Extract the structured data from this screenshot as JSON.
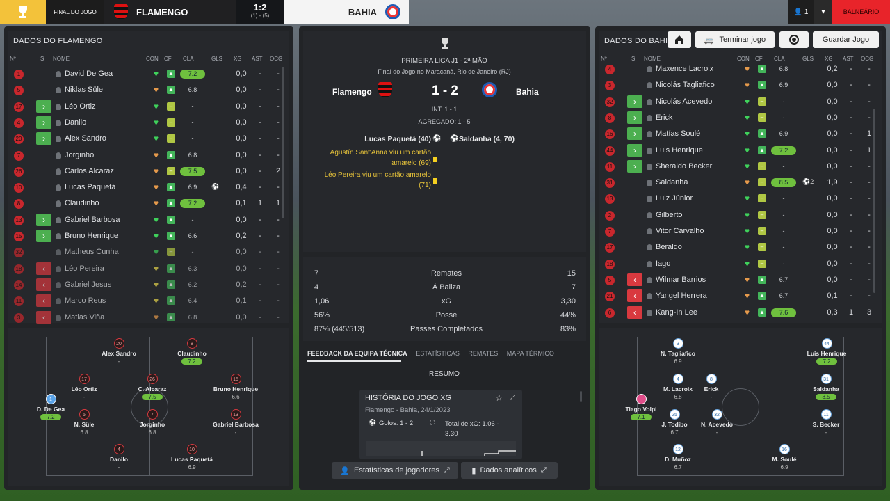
{
  "topbar": {
    "final_label": "FINAL DO JOGO",
    "home": "FLAMENGO",
    "score": "1:2",
    "score_sub": "(1) - (5)",
    "away": "BAHIA",
    "user_count": "1",
    "balneario": "BALNEÁRIO"
  },
  "actions": {
    "home_icon": "home-icon",
    "end_label": "Terminar jogo",
    "save_label": "Guardar Jogo"
  },
  "columns": {
    "num": "Nº",
    "s": "S",
    "name": "NOME",
    "con": "CON",
    "cf": "CF",
    "cla": "CLA",
    "gls": "GLS",
    "xg": "XG",
    "ast": "AST",
    "ocg": "OCG"
  },
  "left_panel": {
    "title": "DADOS DO FLAMENGO",
    "players": [
      {
        "num": "1",
        "sub": "",
        "name": "David De Gea",
        "con": "green",
        "cf": "up",
        "cla": "7.2",
        "cla_hi": true,
        "gls": "",
        "xg": "0,0",
        "ast": "-",
        "ocg": "-"
      },
      {
        "num": "5",
        "sub": "",
        "name": "Niklas Süle",
        "con": "orange",
        "cf": "up",
        "cla": "6.8",
        "cla_hi": false,
        "gls": "",
        "xg": "0,0",
        "ast": "-",
        "ocg": "-"
      },
      {
        "num": "17",
        "sub": "in",
        "name": "Léo Ortiz",
        "con": "green",
        "cf": "flat",
        "cla": "-",
        "cla_hi": false,
        "gls": "",
        "xg": "0,0",
        "ast": "-",
        "ocg": "-"
      },
      {
        "num": "4",
        "sub": "in",
        "name": "Danilo",
        "con": "green",
        "cf": "flat",
        "cla": "-",
        "cla_hi": false,
        "gls": "",
        "xg": "0,0",
        "ast": "-",
        "ocg": "-"
      },
      {
        "num": "20",
        "sub": "in",
        "name": "Alex Sandro",
        "con": "green",
        "cf": "flat",
        "cla": "-",
        "cla_hi": false,
        "gls": "",
        "xg": "0,0",
        "ast": "-",
        "ocg": "-"
      },
      {
        "num": "7",
        "sub": "",
        "name": "Jorginho",
        "con": "orange",
        "cf": "up",
        "cla": "6.8",
        "cla_hi": false,
        "gls": "",
        "xg": "0,0",
        "ast": "-",
        "ocg": "-"
      },
      {
        "num": "26",
        "sub": "",
        "name": "Carlos Alcaraz",
        "con": "orange",
        "cf": "flat",
        "cla": "7.5",
        "cla_hi": true,
        "gls": "",
        "xg": "0,0",
        "ast": "-",
        "ocg": "2"
      },
      {
        "num": "10",
        "sub": "",
        "name": "Lucas Paquetá",
        "con": "orange",
        "cf": "up",
        "cla": "6.9",
        "cla_hi": false,
        "gls": "⚽",
        "xg": "0,4",
        "ast": "-",
        "ocg": "-"
      },
      {
        "num": "8",
        "sub": "",
        "name": "Claudinho",
        "con": "orange",
        "cf": "up",
        "cla": "7.2",
        "cla_hi": true,
        "gls": "",
        "xg": "0,1",
        "ast": "1",
        "ocg": "1"
      },
      {
        "num": "13",
        "sub": "in",
        "name": "Gabriel Barbosa",
        "con": "green",
        "cf": "up",
        "cla": "-",
        "cla_hi": false,
        "gls": "",
        "xg": "0,0",
        "ast": "-",
        "ocg": "-"
      },
      {
        "num": "15",
        "sub": "in",
        "name": "Bruno Henrique",
        "con": "green",
        "cf": "up",
        "cla": "6.6",
        "cla_hi": false,
        "gls": "",
        "xg": "0,2",
        "ast": "-",
        "ocg": "-"
      },
      {
        "num": "32",
        "sub": "",
        "name": "Matheus Cunha",
        "con": "green",
        "cf": "flat",
        "cla": "-",
        "cla_hi": false,
        "gls": "",
        "xg": "0,0",
        "ast": "-",
        "ocg": "-"
      },
      {
        "num": "18",
        "sub": "out",
        "name": "Léo Pereira",
        "con": "yellow",
        "cf": "up",
        "cla": "6.3",
        "cla_hi": false,
        "gls": "",
        "xg": "0,0",
        "ast": "-",
        "ocg": "-"
      },
      {
        "num": "14",
        "sub": "out",
        "name": "Gabriel Jesus",
        "con": "yellow",
        "cf": "up",
        "cla": "6.2",
        "cla_hi": false,
        "gls": "",
        "xg": "0,2",
        "ast": "-",
        "ocg": "-"
      },
      {
        "num": "11",
        "sub": "out",
        "name": "Marco Reus",
        "con": "yellow",
        "cf": "up",
        "cla": "6.4",
        "cla_hi": false,
        "gls": "",
        "xg": "0,1",
        "ast": "-",
        "ocg": "-"
      },
      {
        "num": "3",
        "sub": "out",
        "name": "Matias Viña",
        "con": "orange",
        "cf": "up",
        "cla": "6.8",
        "cla_hi": false,
        "gls": "",
        "xg": "0,0",
        "ast": "-",
        "ocg": "-"
      }
    ],
    "lineup": [
      {
        "num": "20",
        "name": "Alex Sandro",
        "rating": "-",
        "hi": false
      },
      {
        "num": "8",
        "name": "Claudinho",
        "rating": "7.2",
        "hi": true
      },
      {
        "num": "17",
        "name": "Léo Ortiz",
        "rating": "-",
        "hi": false
      },
      {
        "num": "26",
        "name": "C. Alcaraz",
        "rating": "7.5",
        "hi": true
      },
      {
        "num": "15",
        "name": "Bruno Henrique",
        "rating": "6.6",
        "hi": false
      },
      {
        "num": "1",
        "name": "D. De Gea",
        "rating": "7.2",
        "hi": true
      },
      {
        "num": "5",
        "name": "N. Süle",
        "rating": "6.8",
        "hi": false
      },
      {
        "num": "7",
        "name": "Jorginho",
        "rating": "6.8",
        "hi": false
      },
      {
        "num": "13",
        "name": "Gabriel Barbosa",
        "rating": "-",
        "hi": false
      },
      {
        "num": "4",
        "name": "Danilo",
        "rating": "-",
        "hi": false
      },
      {
        "num": "10",
        "name": "Lucas Paquetá",
        "rating": "6.9",
        "hi": false
      }
    ]
  },
  "center": {
    "competition": "PRIMEIRA LIGA J1 - 2ª MÃO",
    "venue": "Final do Jogo no Maracanã, Rio de Janeiro (RJ)",
    "home": "Flamengo",
    "away": "Bahia",
    "score": "1 - 2",
    "int": "INT: 1 - 1",
    "agg": "AGREGADO: 1 - 5",
    "home_scorer": "Lucas Paquetá (40)",
    "away_scorer": "Saldanha (4, 70)",
    "event1": "Agustín Sant'Anna viu um cartão amarelo (69)",
    "event2": "Léo Pereira viu um cartão amarelo (71)",
    "stats": [
      {
        "l": "7",
        "m": "Remates",
        "r": "15"
      },
      {
        "l": "4",
        "m": "À Baliza",
        "r": "7"
      },
      {
        "l": "1,06",
        "m": "xG",
        "r": "3,30"
      },
      {
        "l": "56%",
        "m": "Posse",
        "r": "44%"
      },
      {
        "l": "87% (445/513)",
        "m": "Passes Completados",
        "r": "83%"
      }
    ],
    "tabs": [
      "FEEDBACK DA EQUIPA TÉCNICA",
      "ESTATÍSTICAS",
      "REMATES",
      "MAPA TÉRMICO"
    ],
    "summary": "RESUMO",
    "card_title": "HISTÓRIA DO JOGO XG",
    "card_sub": "Flamengo - Bahia, 24/1/2023",
    "card_goals": "Golos: 1 - 2",
    "card_xg": "Total de xG: 1.06 - 3.30",
    "btn_players": "Estatísticas de jogadores",
    "btn_data": "Dados analíticos"
  },
  "right_panel": {
    "title": "DADOS DO BAHIA",
    "players": [
      {
        "num": "4",
        "sub": "",
        "name": "Maxence Lacroix",
        "con": "orange",
        "cf": "up",
        "cla": "6.8",
        "cla_hi": false,
        "gls": "",
        "xg": "0,2",
        "ast": "-",
        "ocg": "-"
      },
      {
        "num": "3",
        "sub": "",
        "name": "Nicolás Tagliafico",
        "con": "orange",
        "cf": "up",
        "cla": "6.9",
        "cla_hi": false,
        "gls": "",
        "xg": "0,0",
        "ast": "-",
        "ocg": "-"
      },
      {
        "num": "32",
        "sub": "in",
        "name": "Nicolás Acevedo",
        "con": "green",
        "cf": "flat",
        "cla": "-",
        "cla_hi": false,
        "gls": "",
        "xg": "0,0",
        "ast": "-",
        "ocg": "-"
      },
      {
        "num": "8",
        "sub": "in",
        "name": "Erick",
        "con": "green",
        "cf": "flat",
        "cla": "-",
        "cla_hi": false,
        "gls": "",
        "xg": "0,0",
        "ast": "-",
        "ocg": "-"
      },
      {
        "num": "16",
        "sub": "in",
        "name": "Matías Soulé",
        "con": "green",
        "cf": "up",
        "cla": "6.9",
        "cla_hi": false,
        "gls": "",
        "xg": "0,0",
        "ast": "-",
        "ocg": "1"
      },
      {
        "num": "44",
        "sub": "in",
        "name": "Luis Henrique",
        "con": "green",
        "cf": "up",
        "cla": "7.2",
        "cla_hi": true,
        "gls": "",
        "xg": "0,0",
        "ast": "-",
        "ocg": "1"
      },
      {
        "num": "11",
        "sub": "in",
        "name": "Sheraldo Becker",
        "con": "green",
        "cf": "flat",
        "cla": "-",
        "cla_hi": false,
        "gls": "",
        "xg": "0,0",
        "ast": "-",
        "ocg": "-"
      },
      {
        "num": "31",
        "sub": "",
        "name": "Saldanha",
        "con": "orange",
        "cf": "flat",
        "cla": "8.5",
        "cla_hi": true,
        "gls": "⚽2",
        "xg": "1,9",
        "ast": "-",
        "ocg": "-"
      },
      {
        "num": "13",
        "sub": "",
        "name": "Luiz Júnior",
        "con": "green",
        "cf": "flat",
        "cla": "-",
        "cla_hi": false,
        "gls": "",
        "xg": "0,0",
        "ast": "-",
        "ocg": "-"
      },
      {
        "num": "2",
        "sub": "",
        "name": "Gilberto",
        "con": "green",
        "cf": "flat",
        "cla": "-",
        "cla_hi": false,
        "gls": "",
        "xg": "0,0",
        "ast": "-",
        "ocg": "-"
      },
      {
        "num": "7",
        "sub": "",
        "name": "Vitor Carvalho",
        "con": "green",
        "cf": "flat",
        "cla": "-",
        "cla_hi": false,
        "gls": "",
        "xg": "0,0",
        "ast": "-",
        "ocg": "-"
      },
      {
        "num": "17",
        "sub": "",
        "name": "Beraldo",
        "con": "green",
        "cf": "flat",
        "cla": "-",
        "cla_hi": false,
        "gls": "",
        "xg": "0,0",
        "ast": "-",
        "ocg": "-"
      },
      {
        "num": "18",
        "sub": "",
        "name": "Iago",
        "con": "green",
        "cf": "flat",
        "cla": "-",
        "cla_hi": false,
        "gls": "",
        "xg": "0,0",
        "ast": "-",
        "ocg": "-"
      },
      {
        "num": "5",
        "sub": "out",
        "name": "Wilmar Barrios",
        "con": "orange",
        "cf": "up",
        "cla": "6.7",
        "cla_hi": false,
        "gls": "",
        "xg": "0,0",
        "ast": "-",
        "ocg": "-"
      },
      {
        "num": "21",
        "sub": "out",
        "name": "Yangel Herrera",
        "con": "orange",
        "cf": "up",
        "cla": "6.7",
        "cla_hi": false,
        "gls": "",
        "xg": "0,1",
        "ast": "-",
        "ocg": "-"
      },
      {
        "num": "6",
        "sub": "out",
        "name": "Kang-In Lee",
        "con": "orange",
        "cf": "up",
        "cla": "7.6",
        "cla_hi": true,
        "gls": "",
        "xg": "0,3",
        "ast": "1",
        "ocg": "3"
      }
    ],
    "lineup": [
      {
        "num": "3",
        "name": "N. Tagliafico",
        "rating": "6.9",
        "hi": false
      },
      {
        "num": "44",
        "name": "Luis Henrique",
        "rating": "7.2",
        "hi": true
      },
      {
        "num": "4",
        "name": "M. Lacroix",
        "rating": "6.8",
        "hi": false
      },
      {
        "num": "8",
        "name": "Erick",
        "rating": "-",
        "hi": false
      },
      {
        "num": "31",
        "name": "Saldanha",
        "rating": "8.5",
        "hi": true
      },
      {
        "num": "",
        "name": "Tiago Volpi",
        "rating": "7.1",
        "hi": true
      },
      {
        "num": "25",
        "name": "J. Todibo",
        "rating": "6.7",
        "hi": false
      },
      {
        "num": "32",
        "name": "N. Acevedo",
        "rating": "-",
        "hi": false
      },
      {
        "num": "11",
        "name": "S. Becker",
        "rating": "-",
        "hi": false
      },
      {
        "num": "12",
        "name": "D. Muñoz",
        "rating": "6.7",
        "hi": false
      },
      {
        "num": "16",
        "name": "M. Soulé",
        "rating": "6.9",
        "hi": false
      }
    ]
  }
}
